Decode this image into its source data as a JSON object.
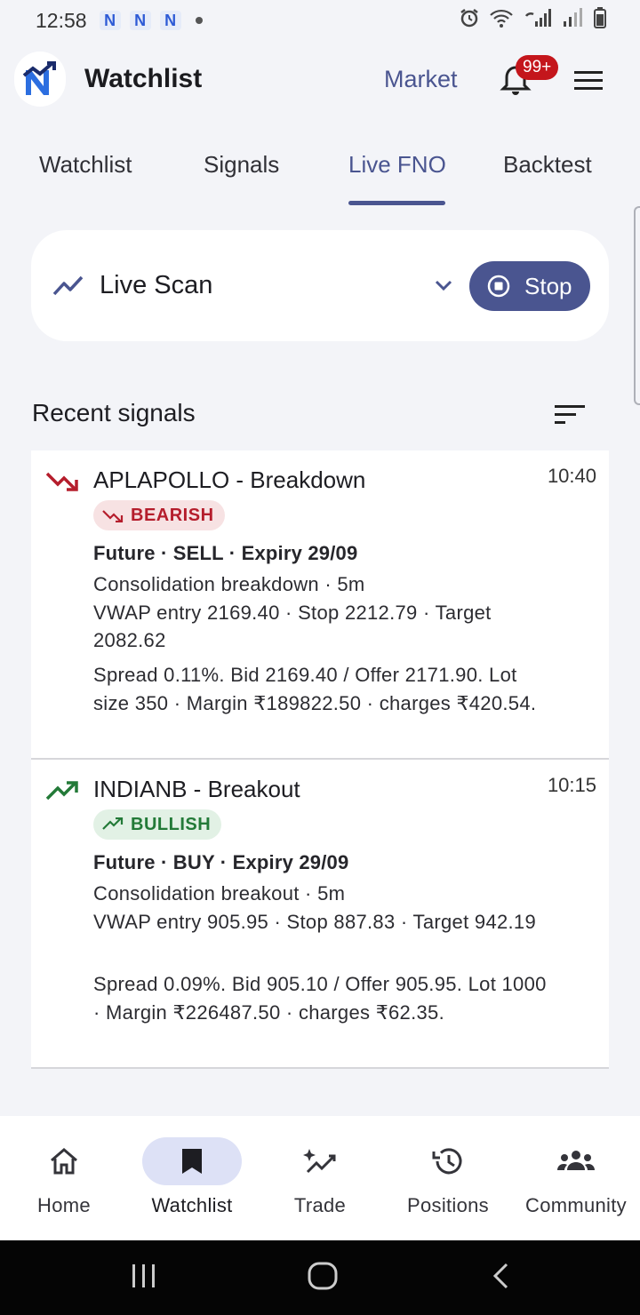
{
  "status_bar": {
    "time": "12:58",
    "app_icons": [
      "N",
      "N",
      "N"
    ]
  },
  "header": {
    "title": "Watchlist",
    "market_link": "Market",
    "notification_badge": "99+"
  },
  "tabs": [
    {
      "label": "Watchlist",
      "active": false
    },
    {
      "label": "Signals",
      "active": false
    },
    {
      "label": "Live FNO",
      "active": true
    },
    {
      "label": "Backtest",
      "active": false
    }
  ],
  "scan": {
    "label": "Live Scan",
    "stop_label": "Stop"
  },
  "recent": {
    "title": "Recent signals"
  },
  "signals": [
    {
      "title": "APLAPOLLO - Breakdown",
      "time": "10:40",
      "chip": "BEARISH",
      "meta": "Future · SELL · Expiry 29/09",
      "desc": "Consolidation breakdown · 5m\nVWAP entry 2169.40 · Stop 2212.79 · Target 2082.62",
      "spread": "Spread 0.11%. Bid 2169.40 / Offer 2171.90. Lot size 350 · Margin ₹189822.50 · charges ₹420.54."
    },
    {
      "title": "INDIANB - Breakout",
      "time": "10:15",
      "chip": "BULLISH",
      "meta": "Future · BUY · Expiry 29/09",
      "desc": "Consolidation breakout · 5m\nVWAP entry 905.95 · Stop 887.83 · Target 942.19",
      "spread": "Spread 0.09%. Bid 905.10 / Offer 905.95. Lot 1000 · Margin ₹226487.50 · charges ₹62.35."
    }
  ],
  "bottom_nav": [
    {
      "label": "Home",
      "icon": "home-icon",
      "active": false
    },
    {
      "label": "Watchlist",
      "icon": "bookmark-icon",
      "active": true
    },
    {
      "label": "Trade",
      "icon": "sparkle-chart-icon",
      "active": false
    },
    {
      "label": "Positions",
      "icon": "history-icon",
      "active": false
    },
    {
      "label": "Community",
      "icon": "people-icon",
      "active": false
    }
  ],
  "colors": {
    "accent": "#4a5590",
    "bearish": "#b51d2c",
    "bullish": "#237a38",
    "badge": "#c4161c"
  }
}
